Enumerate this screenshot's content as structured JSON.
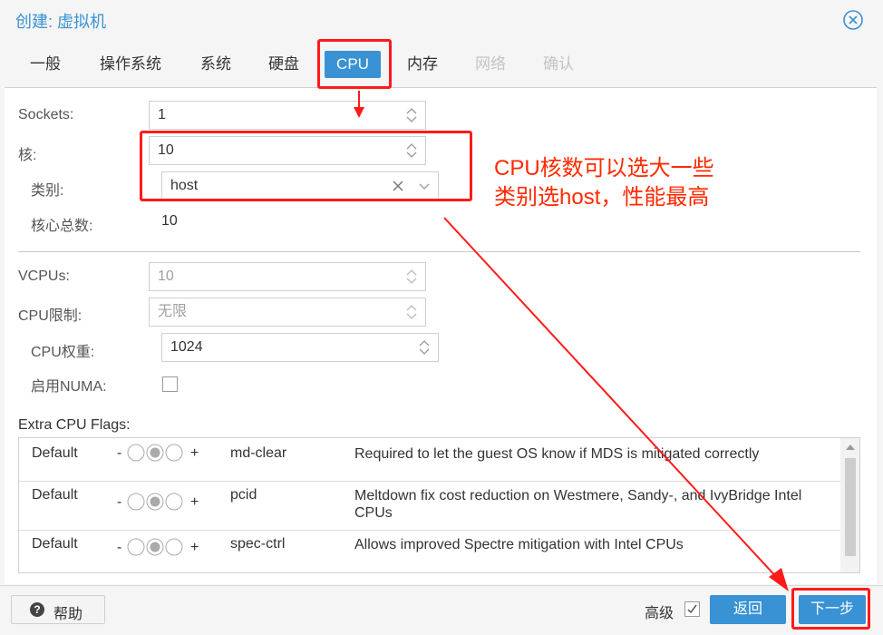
{
  "window": {
    "title": "创建: 虚拟机"
  },
  "tabs": [
    {
      "label": "一般",
      "state": "normal"
    },
    {
      "label": "操作系统",
      "state": "normal"
    },
    {
      "label": "系统",
      "state": "normal"
    },
    {
      "label": "硬盘",
      "state": "normal"
    },
    {
      "label": "CPU",
      "state": "active"
    },
    {
      "label": "内存",
      "state": "normal"
    },
    {
      "label": "网络",
      "state": "disabled"
    },
    {
      "label": "确认",
      "state": "disabled"
    }
  ],
  "cpu": {
    "sockets_label": "Sockets:",
    "sockets_value": "1",
    "cores_label": "核:",
    "cores_value": "10",
    "type_label": "类别:",
    "type_value": "host",
    "total_cores_label": "核心总数:",
    "total_cores_value": "10",
    "vcpus_label": "VCPUs:",
    "vcpus_value": "10",
    "cpulimit_label": "CPU限制:",
    "cpulimit_value": "无限",
    "cpuweight_label": "CPU权重:",
    "cpuweight_value": "1024",
    "numa_label": "启用NUMA:",
    "numa_checked": false
  },
  "flags": {
    "title": "Extra CPU Flags:",
    "rows": [
      {
        "state": "Default",
        "minus": "-",
        "plus": "+",
        "name": "md-clear",
        "description": "Required to let the guest OS know if MDS is mitigated correctly"
      },
      {
        "state": "Default",
        "minus": "-",
        "plus": "+",
        "name": "pcid",
        "description": "Meltdown fix cost reduction on Westmere, Sandy-, and IvyBridge Intel CPUs"
      },
      {
        "state": "Default",
        "minus": "-",
        "plus": "+",
        "name": "spec-ctrl",
        "description": "Allows improved Spectre mitigation with Intel CPUs"
      }
    ]
  },
  "footer": {
    "help_label": "帮助",
    "help_icon": "?",
    "advanced_label": "高级",
    "advanced_checked": true,
    "back_label": "返回",
    "next_label": "下一步"
  },
  "annotation": {
    "line1": "CPU核数可以选大一些",
    "line2": "类别选host，性能最高",
    "color": "#ff1a1a"
  },
  "colors": {
    "accent": "#3892d4",
    "annotation": "#ff1a1a"
  }
}
